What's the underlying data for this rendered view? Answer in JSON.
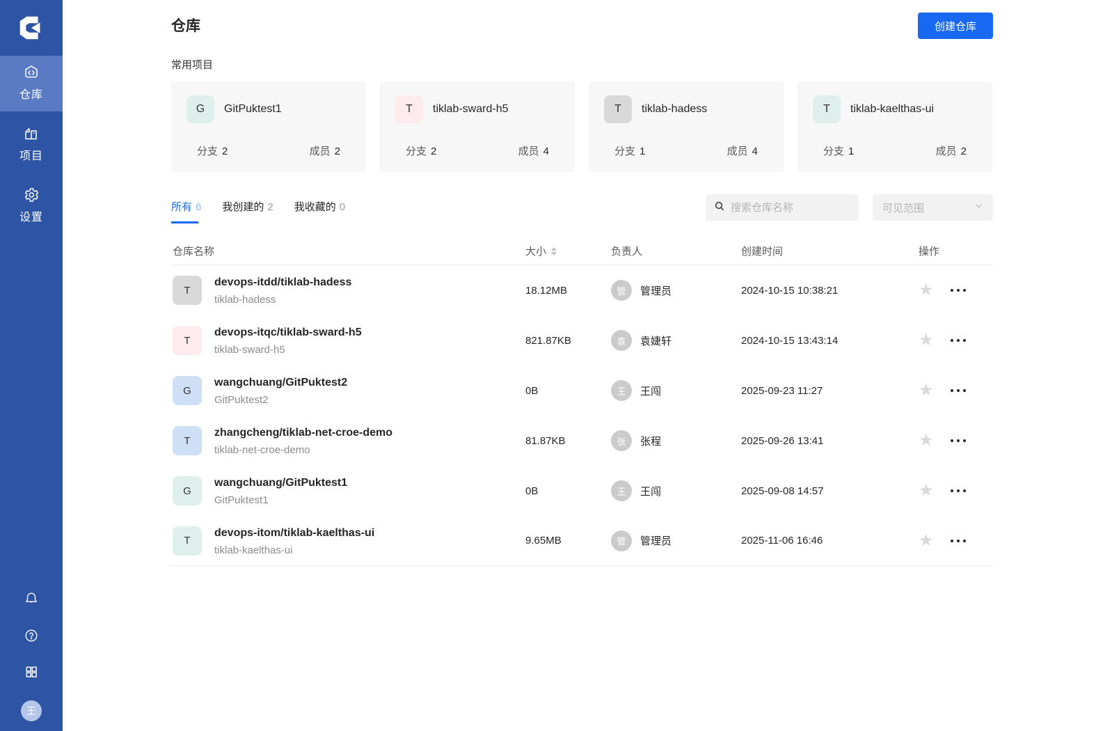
{
  "colors": {
    "sidebar": "#2e54a6",
    "sidebar_active": "#5b7ac4",
    "accent_blue": "#1868f1",
    "avatar_teal": "#dff0ec",
    "avatar_pink": "#fdebed",
    "avatar_gray": "#d9d9d9",
    "avatar_blue": "#cfe0f6"
  },
  "sidebar": {
    "nav": [
      {
        "label": "仓库"
      },
      {
        "label": "项目"
      },
      {
        "label": "设置"
      }
    ],
    "avatar_text": "王"
  },
  "header": {
    "title": "仓库",
    "create_button": "创建仓库"
  },
  "favorites": {
    "section_title": "常用项目",
    "branch_label": "分支",
    "member_label": "成员",
    "cards": [
      {
        "initial": "G",
        "avatar_bg": "#dff0ec",
        "name": "GitPuktest1",
        "branches": "2",
        "members": "2"
      },
      {
        "initial": "T",
        "avatar_bg": "#fdebed",
        "name": "tiklab-sward-h5",
        "branches": "2",
        "members": "4"
      },
      {
        "initial": "T",
        "avatar_bg": "#d9d9d9",
        "name": "tiklab-hadess",
        "branches": "1",
        "members": "4"
      },
      {
        "initial": "T",
        "avatar_bg": "#dff0ec",
        "name": "tiklab-kaelthas-ui",
        "branches": "1",
        "members": "2"
      }
    ]
  },
  "tabs": [
    {
      "label": "所有",
      "count": "6"
    },
    {
      "label": "我创建的",
      "count": "2"
    },
    {
      "label": "我收藏的",
      "count": "0"
    }
  ],
  "search": {
    "placeholder": "搜索仓库名称"
  },
  "visibility_filter": {
    "label": "可见范围"
  },
  "table": {
    "columns": [
      "仓库名称",
      "大小",
      "负责人",
      "创建时间",
      "操作"
    ],
    "rows": [
      {
        "initial": "T",
        "avatar_bg": "#d9d9d9",
        "name": "devops-itdd/tiklab-hadess",
        "subtitle": "tiklab-hadess",
        "size": "18.12MB",
        "owner_initial": "管",
        "owner": "管理员",
        "created": "2024-10-15 10:38:21"
      },
      {
        "initial": "T",
        "avatar_bg": "#fdebed",
        "name": "devops-itqc/tiklab-sward-h5",
        "subtitle": "tiklab-sward-h5",
        "size": "821.87KB",
        "owner_initial": "袁",
        "owner": "袁婕轩",
        "created": "2024-10-15 13:43:14"
      },
      {
        "initial": "G",
        "avatar_bg": "#cfe0f6",
        "name": "wangchuang/GitPuktest2",
        "subtitle": "GitPuktest2",
        "size": "0B",
        "owner_initial": "王",
        "owner": "王闯",
        "created": "2025-09-23 11:27"
      },
      {
        "initial": "T",
        "avatar_bg": "#cfe0f6",
        "name": "zhangcheng/tiklab-net-croe-demo",
        "subtitle": "tiklab-net-croe-demo",
        "size": "81.87KB",
        "owner_initial": "张",
        "owner": "张程",
        "created": "2025-09-26 13:41"
      },
      {
        "initial": "G",
        "avatar_bg": "#dff0ec",
        "name": "wangchuang/GitPuktest1",
        "subtitle": "GitPuktest1",
        "size": "0B",
        "owner_initial": "王",
        "owner": "王闯",
        "created": "2025-09-08 14:57"
      },
      {
        "initial": "T",
        "avatar_bg": "#dff0ec",
        "name": "devops-itom/tiklab-kaelthas-ui",
        "subtitle": "tiklab-kaelthas-ui",
        "size": "9.65MB",
        "owner_initial": "管",
        "owner": "管理员",
        "created": "2025-11-06 16:46"
      }
    ]
  }
}
